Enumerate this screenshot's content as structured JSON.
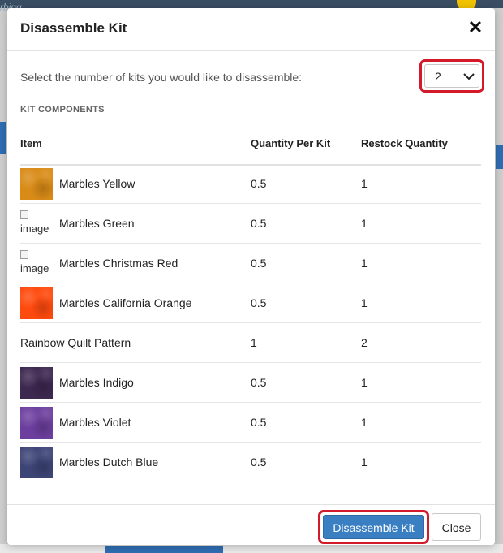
{
  "backdrop": {
    "partial_text": "rbing"
  },
  "modal": {
    "title": "Disassemble Kit",
    "close_glyph": "✕",
    "prompt": "Select the number of kits you would like to disassemble:",
    "kit_count": {
      "selected": "2",
      "icon": "chevron-down-icon"
    },
    "section_label": "KIT COMPONENTS",
    "columns": {
      "item": "Item",
      "quantity_per_kit": "Quantity Per Kit",
      "restock_quantity": "Restock Quantity"
    },
    "broken_image_alt": "image",
    "rows": [
      {
        "name": "Marbles Yellow",
        "qty_per_kit": "0.5",
        "restock": "1",
        "image": "swatch",
        "swatch_color": "#d98b17"
      },
      {
        "name": "Marbles Green",
        "qty_per_kit": "0.5",
        "restock": "1",
        "image": "broken"
      },
      {
        "name": "Marbles Christmas Red",
        "qty_per_kit": "0.5",
        "restock": "1",
        "image": "broken"
      },
      {
        "name": "Marbles California Orange",
        "qty_per_kit": "0.5",
        "restock": "1",
        "image": "swatch",
        "swatch_color": "#ff4a0e"
      },
      {
        "name": "Rainbow Quilt Pattern",
        "qty_per_kit": "1",
        "restock": "2",
        "image": "none"
      },
      {
        "name": "Marbles Indigo",
        "qty_per_kit": "0.5",
        "restock": "1",
        "image": "swatch",
        "swatch_color": "#3d2850"
      },
      {
        "name": "Marbles Violet",
        "qty_per_kit": "0.5",
        "restock": "1",
        "image": "swatch",
        "swatch_color": "#6c3f9e"
      },
      {
        "name": "Marbles Dutch Blue",
        "qty_per_kit": "0.5",
        "restock": "1",
        "image": "swatch",
        "swatch_color": "#3d4476"
      }
    ],
    "footer": {
      "disassemble_label": "Disassemble Kit",
      "close_label": "Close"
    }
  },
  "colors": {
    "primary_button": "#3a7fc1",
    "highlight": "#d21a2a"
  }
}
